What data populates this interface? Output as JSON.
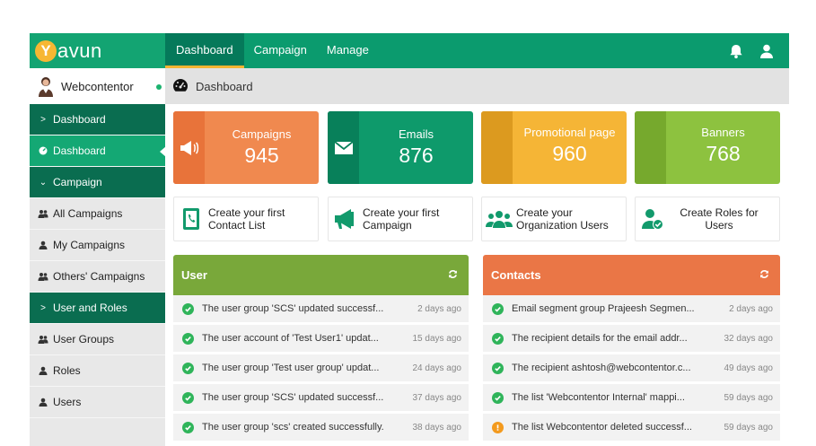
{
  "brand": {
    "logo_letter": "Y",
    "logo_text": "avun"
  },
  "nav": {
    "items": [
      "Dashboard",
      "Campaign",
      "Manage"
    ]
  },
  "user": {
    "name": "Webcontentor"
  },
  "sidebar": {
    "items": [
      {
        "label": "Dashboard",
        "prefix": ">",
        "kind": "section"
      },
      {
        "label": "Dashboard",
        "icon": "dashboard-icon",
        "kind": "active"
      },
      {
        "label": "Campaign",
        "prefix": "⌄",
        "kind": "section"
      },
      {
        "label": "All Campaigns",
        "icon": "users-icon",
        "kind": "plain"
      },
      {
        "label": "My Campaigns",
        "icon": "user-icon",
        "kind": "plain"
      },
      {
        "label": "Others' Campaigns",
        "icon": "users-icon",
        "kind": "plain"
      },
      {
        "label": "User and Roles",
        "prefix": ">",
        "kind": "section"
      },
      {
        "label": "User Groups",
        "icon": "users-icon",
        "kind": "plain"
      },
      {
        "label": "Roles",
        "icon": "user-icon",
        "kind": "plain"
      },
      {
        "label": "Users",
        "icon": "user-icon",
        "kind": "plain"
      }
    ]
  },
  "breadcrumb": {
    "label": "Dashboard"
  },
  "cards": [
    {
      "label": "Campaigns",
      "value": "945",
      "color": "#f0894f",
      "side_color": "#e8733a",
      "icon": "megaphone-icon"
    },
    {
      "label": "Emails",
      "value": "876",
      "color": "#0e9a6b",
      "side_color": "#08805a",
      "icon": "envelope-icon"
    },
    {
      "label": "Promotional page",
      "value": "960",
      "color": "#f5b536",
      "side_color": "#dc9a1f",
      "icon": ""
    },
    {
      "label": "Banners",
      "value": "768",
      "color": "#8dc23f",
      "side_color": "#76a92d",
      "icon": ""
    }
  ],
  "quick_actions": [
    {
      "line1": "Create your first",
      "line2": "Contact List",
      "icon": "phonebook-icon"
    },
    {
      "line1": "Create your first",
      "line2": "Campaign",
      "icon": "megaphone-icon"
    },
    {
      "line1": "Create your",
      "line2": "Organization Users",
      "icon": "group-icon"
    },
    {
      "line1": "Create Roles for",
      "line2": "Users",
      "icon": "user-check-icon"
    }
  ],
  "user_panel": {
    "title": "User",
    "color": "#79a83a",
    "rows": [
      {
        "text": "The user group 'SCS' updated successf...",
        "time": "2 days ago",
        "status": "success"
      },
      {
        "text": "The user account of 'Test User1' updat...",
        "time": "15 days ago",
        "status": "success"
      },
      {
        "text": "The user group 'Test user group' updat...",
        "time": "24 days ago",
        "status": "success"
      },
      {
        "text": "The user group 'SCS' updated successf...",
        "time": "37 days ago",
        "status": "success"
      },
      {
        "text": "The user group 'scs' created successfully.",
        "time": "38 days ago",
        "status": "success"
      }
    ]
  },
  "contacts_panel": {
    "title": "Contacts",
    "color": "#ea7646",
    "rows": [
      {
        "text": "Email segment group Prajeesh Segmen...",
        "time": "2 days ago",
        "status": "success"
      },
      {
        "text": "The recipient details for the email addr...",
        "time": "32 days ago",
        "status": "success"
      },
      {
        "text": "The recipient ashtosh@webcontentor.c...",
        "time": "49 days ago",
        "status": "success"
      },
      {
        "text": "The list 'Webcontentor Internal' mappi...",
        "time": "59 days ago",
        "status": "success"
      },
      {
        "text": "The list Webcontentor deleted successf...",
        "time": "59 days ago",
        "status": "warning"
      }
    ]
  },
  "colors": {
    "success": "#2fb45a",
    "warning": "#f39a1e",
    "topbar": "#0b9b6e",
    "sidebar_section": "#0a6d50"
  }
}
